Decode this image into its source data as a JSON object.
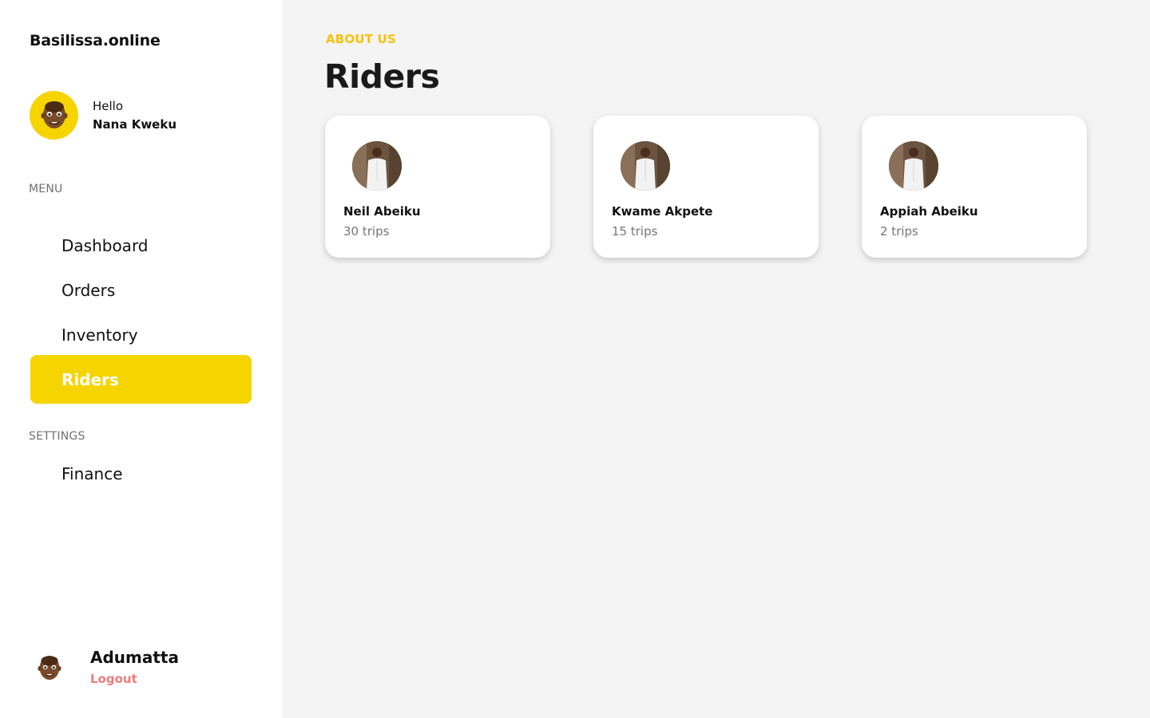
{
  "sidebar": {
    "brand": "Basilissa.online",
    "greeting": {
      "hello": "Hello",
      "name": "Nana Kweku"
    },
    "menu_label": "MENU",
    "menu_items": [
      {
        "label": "Dashboard",
        "active": false
      },
      {
        "label": "Orders",
        "active": false
      },
      {
        "label": "Inventory",
        "active": false
      },
      {
        "label": "Riders",
        "active": true
      }
    ],
    "settings_label": "SETTINGS",
    "settings_items": [
      {
        "label": "Finance",
        "active": false
      }
    ],
    "footer": {
      "name": "Adumatta",
      "logout_label": "Logout"
    }
  },
  "main": {
    "eyebrow": "ABOUT US",
    "title": "Riders",
    "riders": [
      {
        "name": "Neil Abeiku",
        "trips": "30 trips"
      },
      {
        "name": "Kwame Akpete",
        "trips": "15 trips"
      },
      {
        "name": "Appiah Abeiku",
        "trips": "2 trips"
      }
    ]
  },
  "colors": {
    "accent": "#f5d400",
    "eyebrow": "#f5c20a",
    "logout": "#f07a7a",
    "background": "#f4f4f4"
  }
}
